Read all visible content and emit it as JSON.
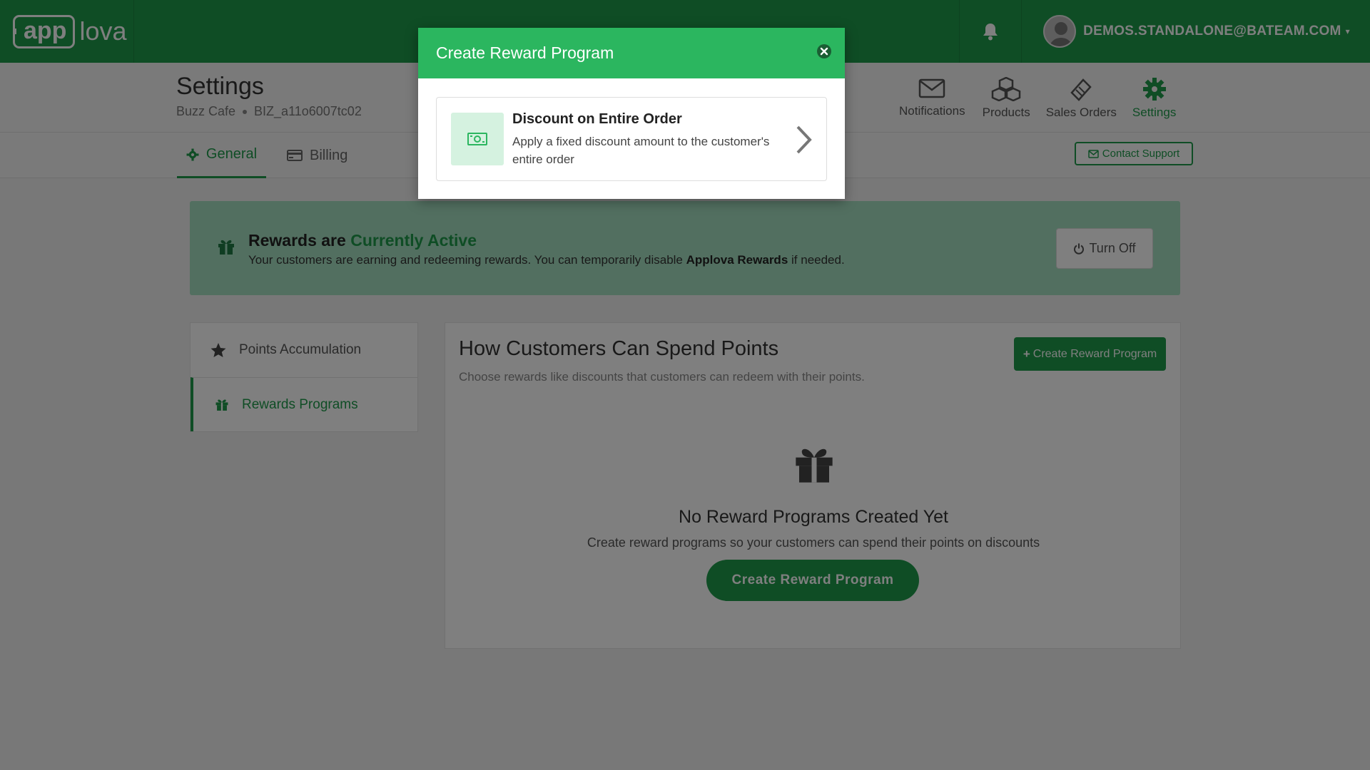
{
  "topbar": {
    "logo_app": "app",
    "logo_lova": "lova",
    "user_email": "DEMOS.STANDALONE@BATEAM.COM"
  },
  "header": {
    "title": "Settings",
    "business_name": "Buzz Cafe",
    "business_id": "BIZ_a11o6007tc02",
    "nav": {
      "notifications": "Notifications",
      "products": "Products",
      "sales_orders": "Sales Orders",
      "settings": "Settings"
    }
  },
  "tabs": {
    "general": "General",
    "billing": "Billing",
    "contact_support": "Contact Support"
  },
  "banner": {
    "title_prefix": "Rewards are",
    "title_status": "Currently Active",
    "text_before": "Your customers are earning and redeeming rewards. You can temporarily disable",
    "text_brand": "Applova Rewards",
    "text_after": "if needed.",
    "turn_off": "Turn Off"
  },
  "side_menu": {
    "points_accumulation": "Points Accumulation",
    "rewards_programs": "Rewards Programs"
  },
  "card": {
    "title": "How Customers Can Spend Points",
    "subtitle": "Choose rewards like discounts that customers can redeem with their points.",
    "create_button": "Create Reward Program",
    "empty_title": "No Reward Programs Created Yet",
    "empty_text": "Create reward programs so your customers can spend their points on discounts",
    "empty_button": "Create Reward Program"
  },
  "modal": {
    "title": "Create Reward Program",
    "option_title": "Discount on Entire Order",
    "option_desc": "Apply a fixed discount amount to the customer's entire order"
  },
  "colors": {
    "primary": "#1f9a4b",
    "modal_header": "#2bb65f",
    "banner_bg": "#a5dec0"
  }
}
